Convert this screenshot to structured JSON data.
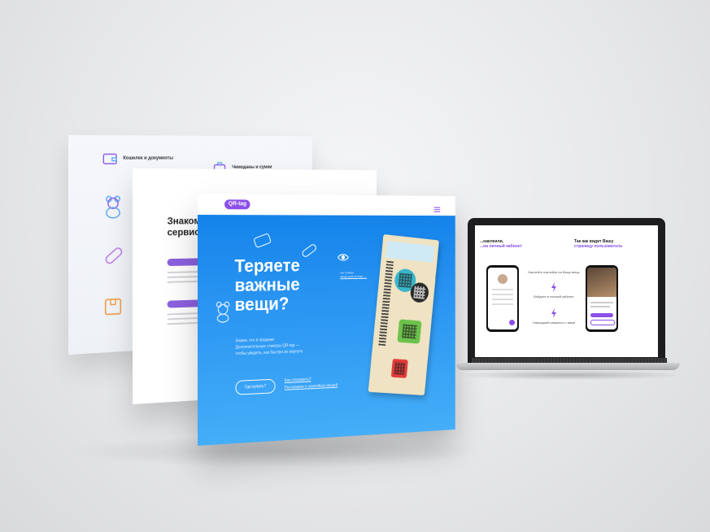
{
  "back_sheet": {
    "items": [
      {
        "label": "Кошелек и документы",
        "icon": "wallet-icon"
      },
      {
        "label": "Чемоданы и сумки",
        "icon": "suitcase-icon"
      }
    ],
    "side_icons": [
      "teddy-bear-icon",
      "pill-icon",
      "box-icon"
    ]
  },
  "middle_sheet": {
    "title_line1": "Знаком",
    "title_line2": "сервис"
  },
  "front_sheet": {
    "logo": "QR-tag",
    "headline": "Теряете важные вещи?",
    "body_line1": "Знаем, что в продаже",
    "body_line2": "Дополнительные стикеры QR-tag —",
    "body_line3": "чтобы увидеть, как быстро их вернуть",
    "cta_button": "Где купить?",
    "link1": "Как отправить?",
    "link2": "Расскажем о наклейках вещей",
    "eye_label_line1": "Не только",
    "eye_label_line2": "вещи для потерь →",
    "accent_color": "#1a86ee"
  },
  "laptop": {
    "left_heading_line1": "...наклеили,",
    "left_heading_line2": "...на личный кабинет",
    "right_heading_line1": "Так как видит Вашу",
    "right_heading_line2": "страницу пользователь",
    "mid_step1": "Наклейте наклейки на Вашу вещь",
    "mid_step2": "Войдите в личный кабинет",
    "mid_step3": "Нашедший свяжется с вами",
    "accent_color": "#8a4fe8"
  }
}
